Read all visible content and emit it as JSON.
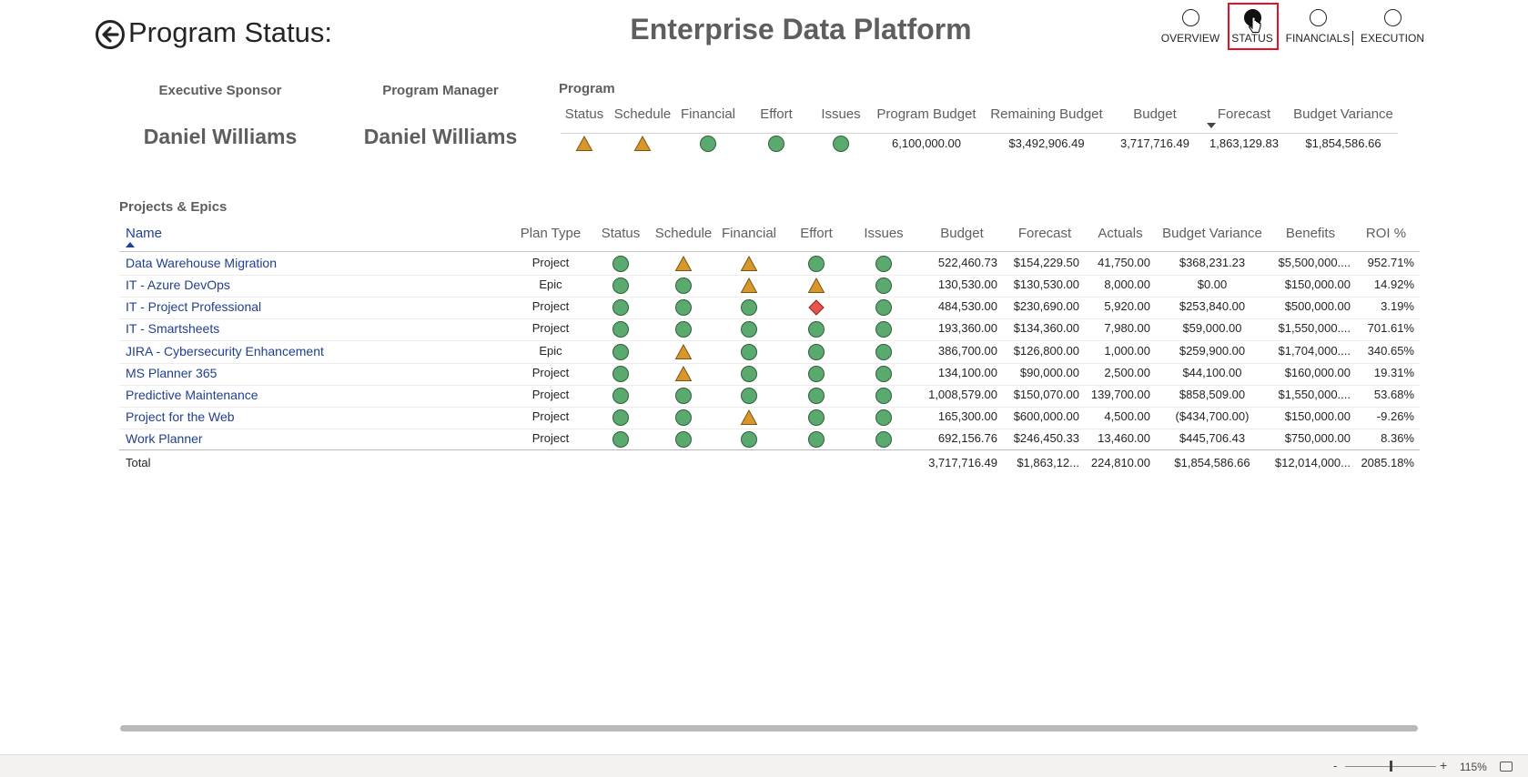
{
  "header": {
    "page_title": "Program Status:",
    "main_title": "Enterprise Data Platform",
    "nav": [
      {
        "label": "OVERVIEW",
        "selected": false
      },
      {
        "label": "STATUS",
        "selected": true
      },
      {
        "label": "FINANCIALS",
        "selected": false
      },
      {
        "label": "EXECUTION",
        "selected": false
      }
    ]
  },
  "people": {
    "sponsor_label": "Executive Sponsor",
    "sponsor_name": "Daniel Williams",
    "manager_label": "Program Manager",
    "manager_name": "Daniel Williams"
  },
  "program": {
    "label": "Program",
    "headers": [
      "Status",
      "Schedule",
      "Financial",
      "Effort",
      "Issues",
      "Program Budget",
      "Remaining Budget",
      "Budget",
      "Forecast",
      "Budget Variance"
    ],
    "indicators": [
      "warning",
      "warning",
      "good",
      "good",
      "good"
    ],
    "values": [
      "6,100,000.00",
      "$3,492,906.49",
      "3,717,716.49",
      "1,863,129.83",
      "$1,854,586.66"
    ]
  },
  "projects": {
    "label": "Projects & Epics",
    "headers": [
      "Name",
      "Plan Type",
      "Status",
      "Schedule",
      "Financial",
      "Effort",
      "Issues",
      "Budget",
      "Forecast",
      "Actuals",
      "Budget Variance",
      "Benefits",
      "ROI %"
    ],
    "rows": [
      {
        "name": "Data Warehouse Migration",
        "plan_type": "Project",
        "indicators": [
          "good",
          "warning",
          "warning",
          "good",
          "good"
        ],
        "budget": "522,460.73",
        "forecast": "$154,229.50",
        "actuals": "41,750.00",
        "variance": "$368,231.23",
        "benefits": "$5,500,000....",
        "roi": "952.71%"
      },
      {
        "name": "IT - Azure DevOps",
        "plan_type": "Epic",
        "indicators": [
          "good",
          "good",
          "warning",
          "warning",
          "good"
        ],
        "budget": "130,530.00",
        "forecast": "$130,530.00",
        "actuals": "8,000.00",
        "variance": "$0.00",
        "benefits": "$150,000.00",
        "roi": "14.92%"
      },
      {
        "name": "IT - Project Professional",
        "plan_type": "Project",
        "indicators": [
          "good",
          "good",
          "good",
          "critical",
          "good"
        ],
        "budget": "484,530.00",
        "forecast": "$230,690.00",
        "actuals": "5,920.00",
        "variance": "$253,840.00",
        "benefits": "$500,000.00",
        "roi": "3.19%"
      },
      {
        "name": "IT - Smartsheets",
        "plan_type": "Project",
        "indicators": [
          "good",
          "good",
          "good",
          "good",
          "good"
        ],
        "budget": "193,360.00",
        "forecast": "$134,360.00",
        "actuals": "7,980.00",
        "variance": "$59,000.00",
        "benefits": "$1,550,000....",
        "roi": "701.61%"
      },
      {
        "name": "JIRA - Cybersecurity Enhancement",
        "plan_type": "Epic",
        "indicators": [
          "good",
          "warning",
          "good",
          "good",
          "good"
        ],
        "budget": "386,700.00",
        "forecast": "$126,800.00",
        "actuals": "1,000.00",
        "variance": "$259,900.00",
        "benefits": "$1,704,000....",
        "roi": "340.65%"
      },
      {
        "name": "MS Planner 365",
        "plan_type": "Project",
        "indicators": [
          "good",
          "warning",
          "good",
          "good",
          "good"
        ],
        "budget": "134,100.00",
        "forecast": "$90,000.00",
        "actuals": "2,500.00",
        "variance": "$44,100.00",
        "benefits": "$160,000.00",
        "roi": "19.31%"
      },
      {
        "name": "Predictive Maintenance",
        "plan_type": "Project",
        "indicators": [
          "good",
          "good",
          "good",
          "good",
          "good"
        ],
        "budget": "1,008,579.00",
        "forecast": "$150,070.00",
        "actuals": "139,700.00",
        "variance": "$858,509.00",
        "benefits": "$1,550,000....",
        "roi": "53.68%"
      },
      {
        "name": "Project for the Web",
        "plan_type": "Project",
        "indicators": [
          "good",
          "good",
          "warning",
          "good",
          "good"
        ],
        "budget": "165,300.00",
        "forecast": "$600,000.00",
        "actuals": "4,500.00",
        "variance": "($434,700.00)",
        "benefits": "$150,000.00",
        "roi": "-9.26%"
      },
      {
        "name": "Work Planner",
        "plan_type": "Project",
        "indicators": [
          "good",
          "good",
          "good",
          "good",
          "good"
        ],
        "budget": "692,156.76",
        "forecast": "$246,450.33",
        "actuals": "13,460.00",
        "variance": "$445,706.43",
        "benefits": "$750,000.00",
        "roi": "8.36%"
      }
    ],
    "total": {
      "label": "Total",
      "budget": "3,717,716.49",
      "forecast": "$1,863,12...",
      "actuals": "224,810.00",
      "variance": "$1,854,586.66",
      "benefits": "$12,014,000...",
      "roi": "2085.18%"
    }
  },
  "statusbar": {
    "zoom_minus": "-",
    "zoom_plus": "+",
    "zoom_level": "115%"
  },
  "colors": {
    "good": "#5aa96e",
    "warning": "#d9962b",
    "critical": "#e8534d",
    "link": "#1f3f8f"
  }
}
